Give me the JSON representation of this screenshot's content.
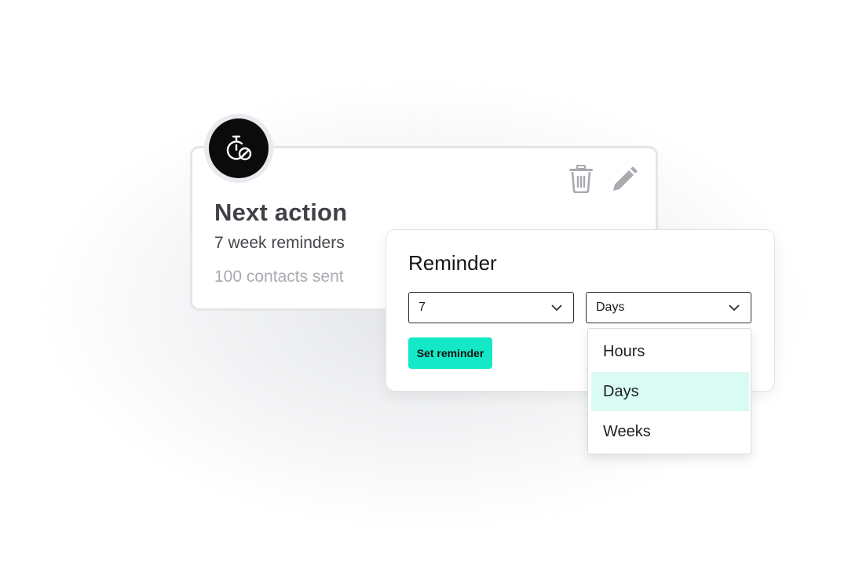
{
  "card": {
    "title": "Next action",
    "subtitle": "7 week reminders",
    "meta": "100 contacts sent",
    "badge_icon": "stopwatch-cancel-icon",
    "actions": [
      {
        "icon": "trash-icon"
      },
      {
        "icon": "pencil-icon"
      }
    ]
  },
  "reminder": {
    "title": "Reminder",
    "quantity": {
      "value": "7",
      "icon": "chevron-down-icon"
    },
    "unit": {
      "value": "Days",
      "icon": "chevron-down-icon"
    },
    "submit_label": "Set reminder",
    "options": [
      {
        "label": "Hours",
        "selected": false
      },
      {
        "label": "Days",
        "selected": true
      },
      {
        "label": "Weeks",
        "selected": false
      }
    ]
  },
  "colors": {
    "accent": "#14e8c6",
    "selected_option": "#d9fbf3",
    "icon_gray": "#a7abb0",
    "title_gray": "#3f4247"
  }
}
